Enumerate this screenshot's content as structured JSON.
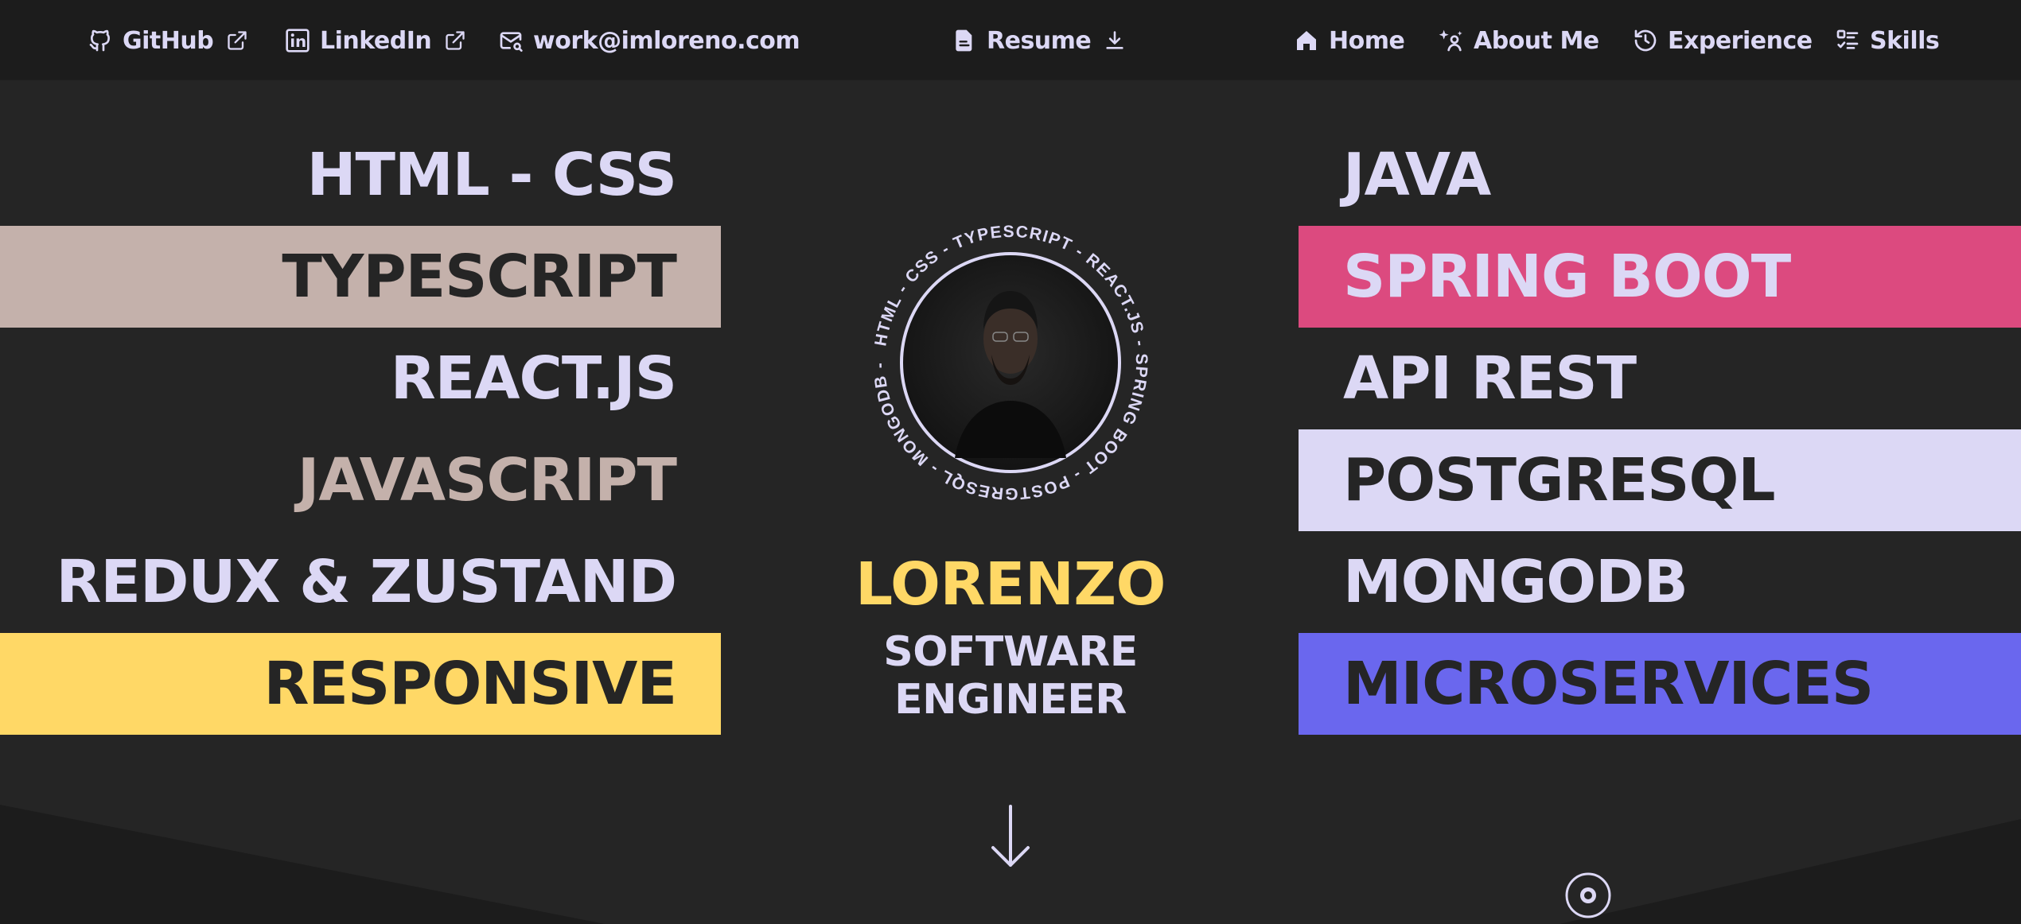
{
  "nav": {
    "github_label": "GitHub",
    "linkedin_label": "LinkedIn",
    "email_label": "work@imloreno.com",
    "resume_label": "Resume",
    "home_label": "Home",
    "about_label": "About Me",
    "experience_label": "Experience",
    "skills_label": "Skills"
  },
  "skills_left": [
    {
      "label": "HTML - CSS"
    },
    {
      "label": "TYPESCRIPT"
    },
    {
      "label": "REACT.JS"
    },
    {
      "label": "JAVASCRIPT"
    },
    {
      "label": "REDUX & ZUSTAND"
    },
    {
      "label": "RESPONSIVE"
    }
  ],
  "skills_right": [
    {
      "label": "JAVA"
    },
    {
      "label": "SPRING BOOT"
    },
    {
      "label": "API REST"
    },
    {
      "label": "POSTGRESQL"
    },
    {
      "label": "MONGODB"
    },
    {
      "label": "MICROSERVICES"
    }
  ],
  "badge": {
    "ring_text": "HTML - CSS - TYPESCRIPT - REACT.JS - SPRING BOOT - POSTGRESQL - MONGODB -"
  },
  "hero": {
    "name": "LORENZO",
    "role": "SOFTWARE ENGINEER"
  },
  "colors": {
    "background": "#252525",
    "nav_background": "#1c1c1c",
    "lavender": "#dcd8f5",
    "dark_text": "#252525",
    "yellow": "#ffd866",
    "taupe": "#c4b1ab",
    "pink": "#dc4a7f",
    "indigo": "#6a67ee"
  }
}
